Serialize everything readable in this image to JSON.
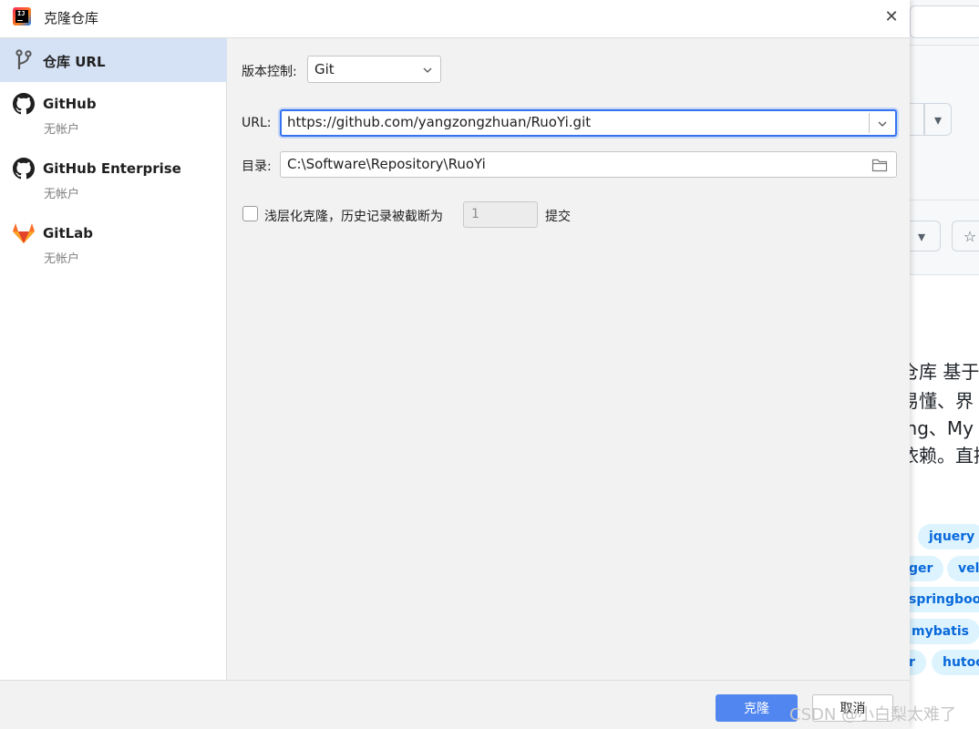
{
  "dialog": {
    "title": "克隆仓库",
    "close_glyph": "✕"
  },
  "sidebar": {
    "items": [
      {
        "label": "仓库 URL",
        "sub": "",
        "icon": "git-branch-icon"
      },
      {
        "label": "GitHub",
        "sub": "无帐户",
        "icon": "github-icon"
      },
      {
        "label": "GitHub Enterprise",
        "sub": "无帐户",
        "icon": "github-icon"
      },
      {
        "label": "GitLab",
        "sub": "无帐户",
        "icon": "gitlab-icon"
      }
    ]
  },
  "form": {
    "vcs_label": "版本控制:",
    "vcs_value": "Git",
    "url_label": "URL:",
    "url_value": "https://github.com/yangzongzhuan/RuoYi.git",
    "dir_label": "目录:",
    "dir_value": "C:\\Software\\Repository\\RuoYi",
    "shallow_label": "浅层化克隆，历史记录被截断为",
    "shallow_depth": "1",
    "shallow_suffix": "提交",
    "shallow_checked": false
  },
  "footer": {
    "clone_label": "克隆",
    "cancel_label": "取消"
  },
  "background": {
    "desc_lines": [
      "仓库 基于S",
      "易懂、界",
      "ing、My",
      "依赖。直接"
    ],
    "tags": [
      "jquery",
      "ger",
      "velc",
      "springboot",
      "mybatis",
      "r",
      "hutoo"
    ],
    "star_glyph": "☆",
    "dropdown_glyph": "▾"
  },
  "watermark": "CSDN @小白梨太难了",
  "colors": {
    "accent": "#3574f0",
    "selection": "#d5e1f5",
    "tag_bg": "#ddf4ff",
    "tag_text": "#0969da"
  }
}
